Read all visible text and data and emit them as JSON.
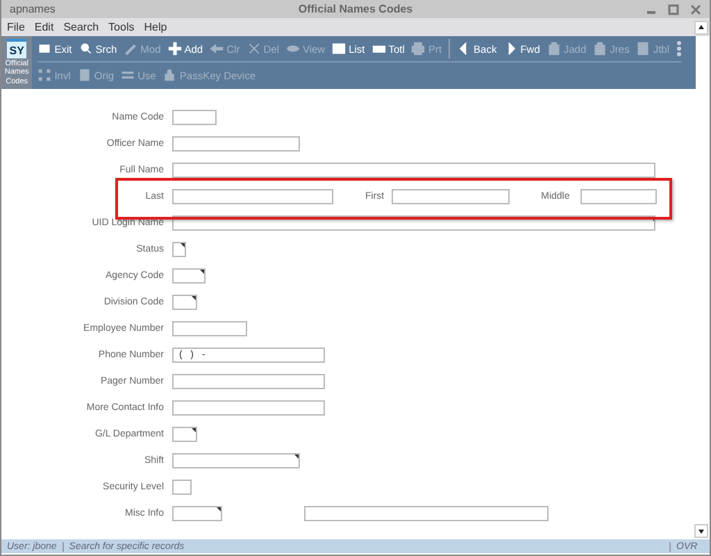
{
  "window": {
    "app": "apnames",
    "title": "Official Names Codes"
  },
  "menu": [
    "File",
    "Edit",
    "Search",
    "Tools",
    "Help"
  ],
  "module": {
    "code": "SY",
    "name": "Official Names Codes"
  },
  "toolbar_rows": [
    [
      {
        "label": "Exit",
        "disabled": false
      },
      {
        "label": "Srch",
        "disabled": false
      },
      {
        "label": "Mod",
        "disabled": true
      },
      {
        "label": "Add",
        "disabled": false
      },
      {
        "label": "Clr",
        "disabled": true
      },
      {
        "label": "Del",
        "disabled": true
      },
      {
        "label": "View",
        "disabled": true
      },
      {
        "label": "List",
        "disabled": false
      },
      {
        "label": "Totl",
        "disabled": false
      },
      {
        "label": "Prt",
        "disabled": true
      },
      {
        "label": "Back",
        "disabled": false
      },
      {
        "label": "Fwd",
        "disabled": false
      },
      {
        "label": "Jadd",
        "disabled": true
      },
      {
        "label": "Jres",
        "disabled": true
      },
      {
        "label": "Jtbl",
        "disabled": true
      }
    ],
    [
      {
        "label": "Invl",
        "disabled": true
      },
      {
        "label": "Orig",
        "disabled": true
      },
      {
        "label": "Use",
        "disabled": true
      },
      {
        "label": "PassKey Device",
        "disabled": true
      }
    ]
  ],
  "form": [
    {
      "label": "Name Code",
      "kind": "text"
    },
    {
      "label": "Officer Name",
      "kind": "text"
    },
    {
      "label": "Full Name",
      "kind": "text"
    },
    {
      "kind": "name_parts",
      "parts": [
        {
          "label": "Last"
        },
        {
          "label": "First"
        },
        {
          "label": "Middle"
        }
      ]
    },
    {
      "label": "UID Login Name",
      "kind": "dropdown"
    },
    {
      "label": "Status",
      "kind": "dropdown"
    },
    {
      "label": "Agency Code",
      "kind": "dropdown"
    },
    {
      "label": "Division Code",
      "kind": "dropdown"
    },
    {
      "label": "Employee Number",
      "kind": "text"
    },
    {
      "label": "Phone Number",
      "kind": "text",
      "value": "(   )   -"
    },
    {
      "label": "Pager Number",
      "kind": "text"
    },
    {
      "label": "More Contact Info",
      "kind": "text"
    },
    {
      "label": "G/L Department",
      "kind": "dropdown"
    },
    {
      "label": "Shift",
      "kind": "dropdown"
    },
    {
      "label": "Security Level",
      "kind": "text"
    },
    {
      "label": "Misc Info",
      "kind": "dropdown",
      "extra_field": true
    }
  ],
  "status_bar": {
    "user": "User: jbone",
    "message": "Search for specific records",
    "mode": "OVR"
  }
}
